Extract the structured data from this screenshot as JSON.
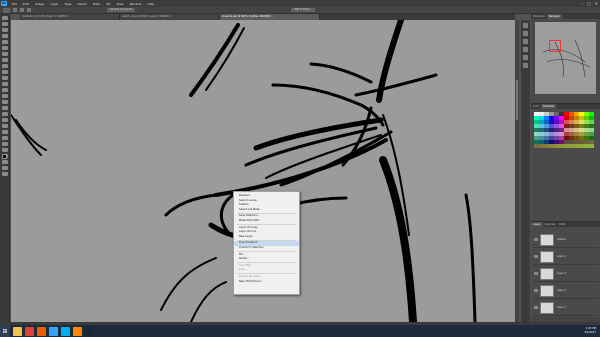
{
  "app": {
    "logo": "Ps"
  },
  "menu": [
    "File",
    "Edit",
    "Image",
    "Layer",
    "Type",
    "Select",
    "Filter",
    "3D",
    "View",
    "Window",
    "Help"
  ],
  "window_buttons": [
    "–",
    "□",
    "✕"
  ],
  "options_bar": [
    "Sample All Layers",
    "Refine Edge..."
  ],
  "tabs": [
    {
      "label": "Untitled-1 @ 33.3% (Layer 1, RGB/8) ×",
      "active": false
    },
    {
      "label": "sketch_v2.psd @ 50% (Layer 3, RGB/8) ×",
      "active": false
    },
    {
      "label": "linework.psd @ 400% (Outline, RGB/8#) ×",
      "active": true
    }
  ],
  "panels": {
    "top_tabs": [
      "Histogram",
      "Navigator"
    ],
    "swatch_tabs": [
      "Color",
      "Swatches"
    ],
    "layer_tabs": [
      "Layers",
      "Channels",
      "Paths"
    ],
    "layers": [
      "Outline",
      "Layer 4",
      "Layer 3",
      "Layer 2",
      "Layer 1"
    ]
  },
  "context_menu": {
    "items": [
      {
        "label": "Deselect",
        "state": "normal"
      },
      {
        "label": "Select Inverse",
        "state": "normal"
      },
      {
        "label": "Feather...",
        "state": "normal"
      },
      {
        "label": "Select and Mask...",
        "state": "normal"
      },
      {
        "sep": true
      },
      {
        "label": "Save Selection...",
        "state": "normal"
      },
      {
        "label": "Make Work Path...",
        "state": "normal"
      },
      {
        "sep": true
      },
      {
        "label": "Layer Via Copy",
        "state": "normal"
      },
      {
        "label": "Layer Via Cut",
        "state": "normal"
      },
      {
        "label": "New Layer...",
        "state": "normal"
      },
      {
        "sep": true
      },
      {
        "label": "Free Transform",
        "state": "highlight"
      },
      {
        "label": "Transform Selection",
        "state": "normal"
      },
      {
        "sep": true
      },
      {
        "label": "Fill...",
        "state": "normal"
      },
      {
        "label": "Stroke...",
        "state": "normal"
      },
      {
        "sep": true
      },
      {
        "label": "Last Filter",
        "state": "disabled"
      },
      {
        "label": "Fade...",
        "state": "disabled"
      },
      {
        "sep": true
      },
      {
        "label": "Render 3D Layer",
        "state": "disabled"
      },
      {
        "label": "New 3D Extrusion",
        "state": "normal"
      }
    ]
  },
  "taskbar": {
    "start_glyph": "⊞",
    "apps": [
      {
        "name": "file-explorer",
        "color": "#f2c14e"
      },
      {
        "name": "chrome",
        "color": "#db4437"
      },
      {
        "name": "firefox",
        "color": "#e66000"
      },
      {
        "name": "photoshop",
        "color": "#31a8ff"
      },
      {
        "name": "skype",
        "color": "#00aff0"
      },
      {
        "name": "vlc",
        "color": "#ff8800"
      },
      {
        "name": "steam",
        "color": "#1b2838"
      }
    ],
    "clock": "1:43 PM",
    "date": "3/1/2017"
  },
  "colors": {
    "canvas_bg": "#9b9b9b",
    "fg_swatch": "#000000",
    "bg_swatch": "#ffffff",
    "accent": "#31a8ff"
  }
}
